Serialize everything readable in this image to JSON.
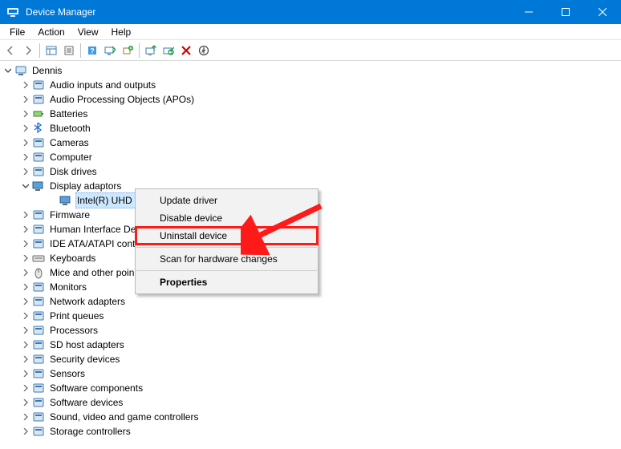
{
  "window": {
    "title": "Device Manager"
  },
  "menu": {
    "file": "File",
    "action": "Action",
    "view": "View",
    "help": "Help"
  },
  "root": {
    "label": "Dennis"
  },
  "categories": [
    {
      "label": "Audio inputs and outputs",
      "expanded": false,
      "icon": "audio"
    },
    {
      "label": "Audio Processing Objects (APOs)",
      "expanded": false,
      "icon": "audio"
    },
    {
      "label": "Batteries",
      "expanded": false,
      "icon": "battery"
    },
    {
      "label": "Bluetooth",
      "expanded": false,
      "icon": "bluetooth"
    },
    {
      "label": "Cameras",
      "expanded": false,
      "icon": "camera"
    },
    {
      "label": "Computer",
      "expanded": false,
      "icon": "computer"
    },
    {
      "label": "Disk drives",
      "expanded": false,
      "icon": "disk"
    },
    {
      "label": "Display adaptors",
      "expanded": true,
      "icon": "display",
      "devices": [
        {
          "label": "Intel(R) UHD Gra",
          "selected": true
        }
      ]
    },
    {
      "label": "Firmware",
      "expanded": false,
      "icon": "chip"
    },
    {
      "label": "Human Interface De",
      "expanded": false,
      "icon": "hid"
    },
    {
      "label": "IDE ATA/ATAPI cont",
      "expanded": false,
      "icon": "ide"
    },
    {
      "label": "Keyboards",
      "expanded": false,
      "icon": "keyboard"
    },
    {
      "label": "Mice and other poin",
      "expanded": false,
      "icon": "mouse"
    },
    {
      "label": "Monitors",
      "expanded": false,
      "icon": "monitor"
    },
    {
      "label": "Network adapters",
      "expanded": false,
      "icon": "network"
    },
    {
      "label": "Print queues",
      "expanded": false,
      "icon": "printer"
    },
    {
      "label": "Processors",
      "expanded": false,
      "icon": "cpu"
    },
    {
      "label": "SD host adapters",
      "expanded": false,
      "icon": "sd"
    },
    {
      "label": "Security devices",
      "expanded": false,
      "icon": "security"
    },
    {
      "label": "Sensors",
      "expanded": false,
      "icon": "sensor"
    },
    {
      "label": "Software components",
      "expanded": false,
      "icon": "software"
    },
    {
      "label": "Software devices",
      "expanded": false,
      "icon": "software"
    },
    {
      "label": "Sound, video and game controllers",
      "expanded": false,
      "icon": "audio"
    },
    {
      "label": "Storage controllers",
      "expanded": false,
      "icon": "storage"
    }
  ],
  "context_menu": {
    "update": "Update driver",
    "disable": "Disable device",
    "uninstall": "Uninstall device",
    "scan": "Scan for hardware changes",
    "properties": "Properties"
  }
}
